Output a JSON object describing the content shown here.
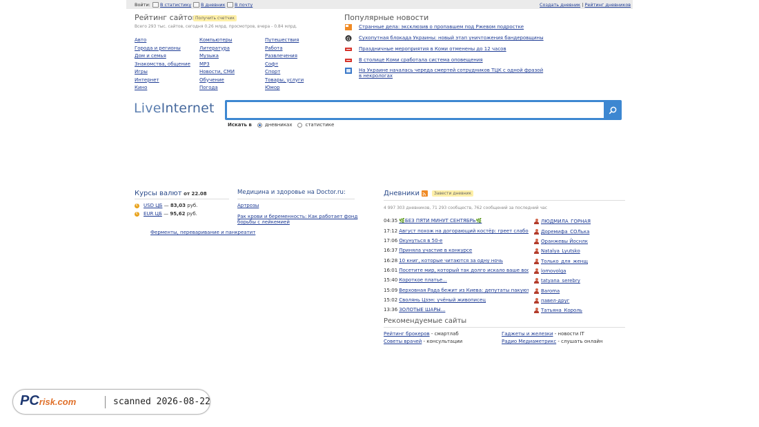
{
  "topbar": {
    "login_label": "Войти:",
    "to_stats": "В статистику",
    "to_diary": "В дневник",
    "to_mail": "В почту",
    "create_diary": "Создать дневник",
    "sep": "|",
    "diary_rating": "Рейтинг дневников"
  },
  "rating": {
    "title": "Рейтинг сайтов",
    "counter_btn": "Получить счетчик",
    "stats": "Всего 293 тыс. сайтов, сегодня 0.26 млрд. просмотров, вчера - 0.84 млрд.",
    "col1": [
      "Авто",
      "Города и регионы",
      "Дом и семья",
      "Знакомства, общение",
      "Игры",
      "Интернет",
      "Кино"
    ],
    "col2": [
      "Компьютеры",
      "Литература",
      "Музыка",
      "MP3",
      "Новости, СМИ",
      "Обучение",
      "Погода"
    ],
    "col3": [
      "Путешествия",
      "Работа",
      "Развлечения",
      "Софт",
      "Спорт",
      "Товары, услуги",
      "Юмор"
    ]
  },
  "news": {
    "title": "Популярные новости",
    "items": [
      {
        "text": "Странные дела: эксклюзив о пропавшем под Ржевом подростке",
        "icon": "rss-icon"
      },
      {
        "text": "Сухопутная блокада Украины: новый этап уничтожения бандеровщины",
        "icon": "g-icon"
      },
      {
        "text": "Праздничные мероприятия в Коми отменены до 12 часов",
        "icon": "news-badge-icon"
      },
      {
        "text": "В столице Коми сработала система оповещения",
        "icon": "news-badge-icon"
      },
      {
        "text": "На Украине началась череда смертей сотрудников ТЦК с одной фразой в некрологах",
        "icon": "doc-icon"
      }
    ]
  },
  "logo": {
    "part1": "Live",
    "part2": "Internet"
  },
  "search": {
    "placeholder": "",
    "where_label": "Искать в",
    "opt_diaries": "дневниках",
    "opt_stats": "статистике"
  },
  "currency": {
    "title": "Курсы валют",
    "date_prefix": "от",
    "date": "22.08",
    "rows": [
      {
        "code": "USD ЦБ",
        "dash": "—",
        "value": "83,03",
        "unit": "руб."
      },
      {
        "code": "EUR ЦБ",
        "dash": "—",
        "value": "95,62",
        "unit": "руб."
      }
    ],
    "ad_link": "Ферменты, переваривание и панкреатит"
  },
  "health": {
    "title": "Медицина и здоровье на Doctor.ru:",
    "links": [
      "Артрозы",
      "Рак крови и беременность: Как работает фонд борьбы с лейкемией"
    ]
  },
  "diaries": {
    "title": "Дневники",
    "start_btn": "Завести дневник",
    "stats": "4 997 303 дневников, 71 293 сообществ, 762 сообщений за последний час",
    "rows": [
      {
        "time": "04:35",
        "title": "🌿БЕЗ ПЯТИ МИНУТ СЕНТЯБРЬ🌿",
        "user": "ЛЮДМИЛА_ГОРНАЯ"
      },
      {
        "time": "17:12",
        "title": "Август похож на догорающий костёр: греет слабо, но",
        "user": "Доремифа_СОЛька"
      },
      {
        "time": "17:06",
        "title": "Окунуться в 50-е",
        "user": "Оранжевы Йоснлк"
      },
      {
        "time": "16:37",
        "title": "Приняла участие в конкурсе",
        "user": "Natalya_Lyutsko"
      },
      {
        "time": "16:28",
        "title": "10 книг, которые читаются за одну ночь",
        "user": "Только_для_женщ"
      },
      {
        "time": "16:01",
        "title": "Посетите мир, который так долго искало ваше воображение",
        "user": "lomovolga"
      },
      {
        "time": "15:40",
        "title": "Короткое платье...",
        "user": "tatyana_serebry"
      },
      {
        "time": "15:09",
        "title": "Верховная Рада бежит из Киева: депутаты пакуют чемоданы",
        "user": "Baroma"
      },
      {
        "time": "15:02",
        "title": "Сволянь Цзэн: учёный живописец",
        "user": "павел-друг"
      },
      {
        "time": "13:36",
        "title": "ЗОЛОТЫЕ ШАРЫ...",
        "user": "Татьяна_Король"
      }
    ]
  },
  "recommended": {
    "title": "Рекомендуемые сайты",
    "items": [
      {
        "link": "Рейтинг брокеров",
        "desc": "- смартлаб"
      },
      {
        "link": "Советы врачей",
        "desc": "- консультации"
      },
      {
        "link": "Гаджеты и железки",
        "desc": "- новости IT"
      },
      {
        "link": "Радио Медиаметрикс",
        "desc": "- слушать онлайн"
      }
    ]
  },
  "stamp": {
    "logo_main": "PC",
    "logo_sub": "risk.com",
    "text": "scanned 2026-08-22"
  },
  "colors": {
    "link": "#1c3a94",
    "search_frame": "#3d87d1",
    "pill": "#fff0a8",
    "euro": "#e8a21c"
  }
}
